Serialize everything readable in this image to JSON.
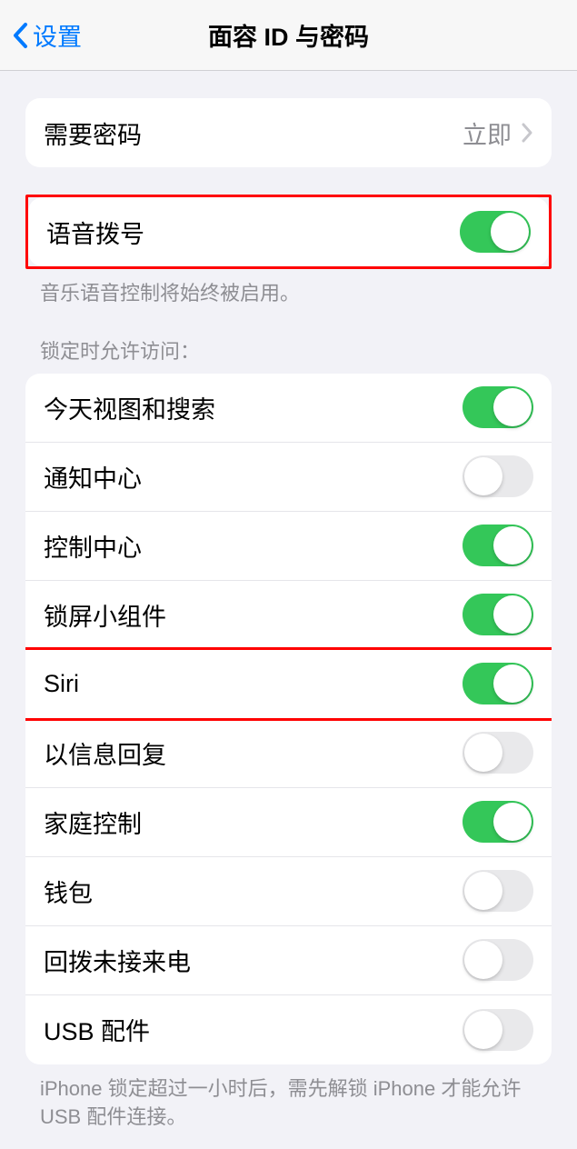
{
  "header": {
    "back_label": "设置",
    "title": "面容 ID 与密码"
  },
  "require_passcode": {
    "label": "需要密码",
    "value": "立即"
  },
  "voice_dial": {
    "label": "语音拨号",
    "footer": "音乐语音控制将始终被启用。"
  },
  "lock_screen_section": {
    "header": "锁定时允许访问：",
    "items": [
      {
        "label": "今天视图和搜索",
        "on": true
      },
      {
        "label": "通知中心",
        "on": false
      },
      {
        "label": "控制中心",
        "on": true
      },
      {
        "label": "锁屏小组件",
        "on": true
      },
      {
        "label": "Siri",
        "on": true
      },
      {
        "label": "以信息回复",
        "on": false
      },
      {
        "label": "家庭控制",
        "on": true
      },
      {
        "label": "钱包",
        "on": false
      },
      {
        "label": "回拨未接来电",
        "on": false
      },
      {
        "label": "USB 配件",
        "on": false
      }
    ],
    "footer": "iPhone 锁定超过一小时后，需先解锁 iPhone 才能允许 USB 配件连接。"
  }
}
